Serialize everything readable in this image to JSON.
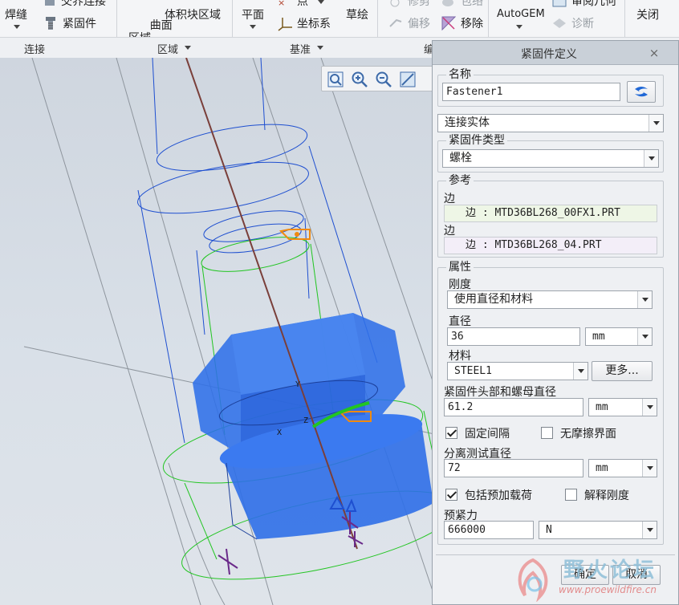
{
  "ribbon": {
    "items": {
      "weld": "焊缝",
      "interface_connect": "交界连接",
      "fastener": "紧固件",
      "surface_region": "曲面\n区域",
      "volume_region": "体积块区域",
      "plane": "平面",
      "point": "点",
      "coord_sys": "坐标系",
      "sketch": "草绘",
      "trim": "修剪",
      "wrap": "包络",
      "offset": "偏移",
      "remove": "移除",
      "autogem": "AutoGEM",
      "review_geometry": "审阅几何",
      "diagnose": "诊断",
      "close": "关闭"
    },
    "groups": {
      "connect": "连接",
      "region": "区域",
      "datum": "基准",
      "edit": "编"
    }
  },
  "dialog": {
    "title": "紧固件定义",
    "close_symbol": "×",
    "name_label": "名称",
    "name_value": "Fastener1",
    "connection_type": "连接实体",
    "fastener_type_label": "紧固件类型",
    "fastener_type_value": "螺栓",
    "reference_label": "参考",
    "ref1_label": "边",
    "ref1_value": "边 : MTD36BL268_00FX1.PRT",
    "ref2_label": "边",
    "ref2_value": "边 : MTD36BL268_04.PRT",
    "properties_label": "属性",
    "stiffness_label": "刚度",
    "stiffness_value": "使用直径和材料",
    "diameter_label": "直径",
    "diameter_value": "36",
    "diameter_unit": "mm",
    "material_label": "材料",
    "material_value": "STEEL1",
    "more_button": "更多...",
    "head_nut_label": "紧固件头部和螺母直径",
    "head_nut_value": "61.2",
    "head_nut_unit": "mm",
    "fixed_spacing_label": "固定间隔",
    "fixed_spacing_checked": true,
    "frictionless_label": "无摩擦界面",
    "frictionless_checked": false,
    "separation_label": "分离测试直径",
    "separation_value": "72",
    "separation_unit": "mm",
    "preload_include_label": "包括预加载荷",
    "preload_include_checked": true,
    "explain_stiffness_label": "解释刚度",
    "explain_stiffness_checked": false,
    "preload_label": "预紧力",
    "preload_value": "666000",
    "preload_unit": "N",
    "ok_button": "确定",
    "cancel_button": "取消"
  },
  "watermark": {
    "title": "野火论坛",
    "url": "www.proewildfire.cn"
  },
  "colors": {
    "solid_blue": "#2f6fe8",
    "wire_blue": "#1e4fd0",
    "wire_green": "#22c522",
    "axis_brown": "#7a3f3a",
    "tag_orange": "#f08a10"
  }
}
